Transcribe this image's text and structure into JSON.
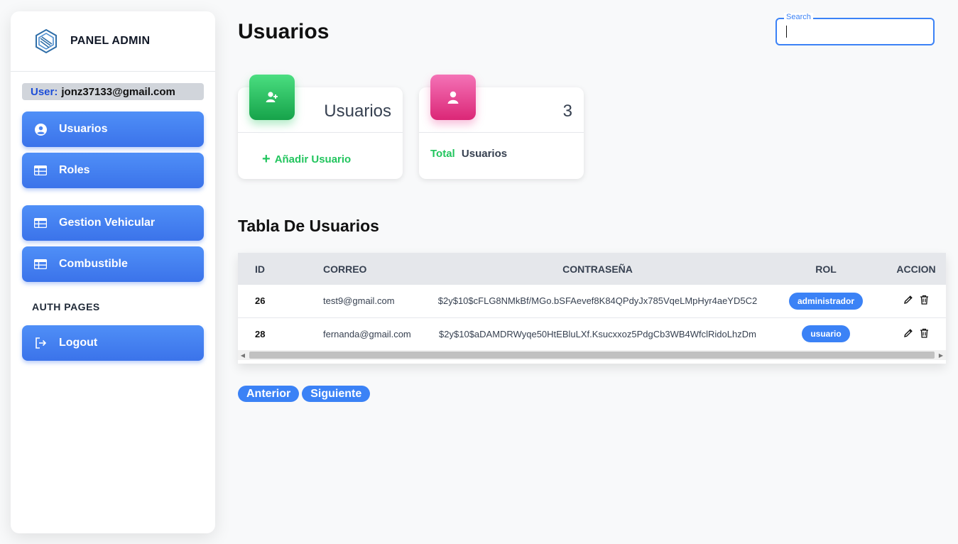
{
  "sidebar": {
    "brand": "PANEL ADMIN",
    "user_label": "User:",
    "user_email": "jonz37133@gmail.com",
    "items": [
      {
        "label": "Usuarios",
        "icon": "user-circle-icon"
      },
      {
        "label": "Roles",
        "icon": "table-icon"
      },
      {
        "label": "Gestion Vehicular",
        "icon": "table-icon"
      },
      {
        "label": "Combustible",
        "icon": "table-icon"
      }
    ],
    "section_label": "AUTH PAGES",
    "logout_label": "Logout"
  },
  "header": {
    "title": "Usuarios",
    "search_label": "Search",
    "search_value": ""
  },
  "cards": [
    {
      "value": "Usuarios",
      "action": "Añadir Usuario",
      "color": "#22c55e"
    },
    {
      "value": "3",
      "foot_accent": "Total",
      "foot_text": "Usuarios",
      "color": "#ec4899"
    }
  ],
  "table": {
    "title": "Tabla De Usuarios",
    "columns": [
      "ID",
      "CORREO",
      "CONTRASEÑA",
      "ROL",
      "ACCION"
    ],
    "rows": [
      {
        "id": "26",
        "correo": "test9@gmail.com",
        "pass": "$2y$10$cFLG8NMkBf/MGo.bSFAevef8K84QPdyJx785VqeLMpHyr4aeYD5C2",
        "rol": "administrador"
      },
      {
        "id": "28",
        "correo": "fernanda@gmail.com",
        "pass": "$2y$10$aDAMDRWyqe50HtEBluLXf.Ksucxxoz5PdgCb3WB4WfclRidoLhzDm",
        "rol": "usuario"
      }
    ]
  },
  "pager": {
    "prev": "Anterior",
    "next": "Siguiente"
  },
  "colors": {
    "accent": "#3b82f6",
    "green": "#22c55e",
    "pink": "#ec4899"
  }
}
